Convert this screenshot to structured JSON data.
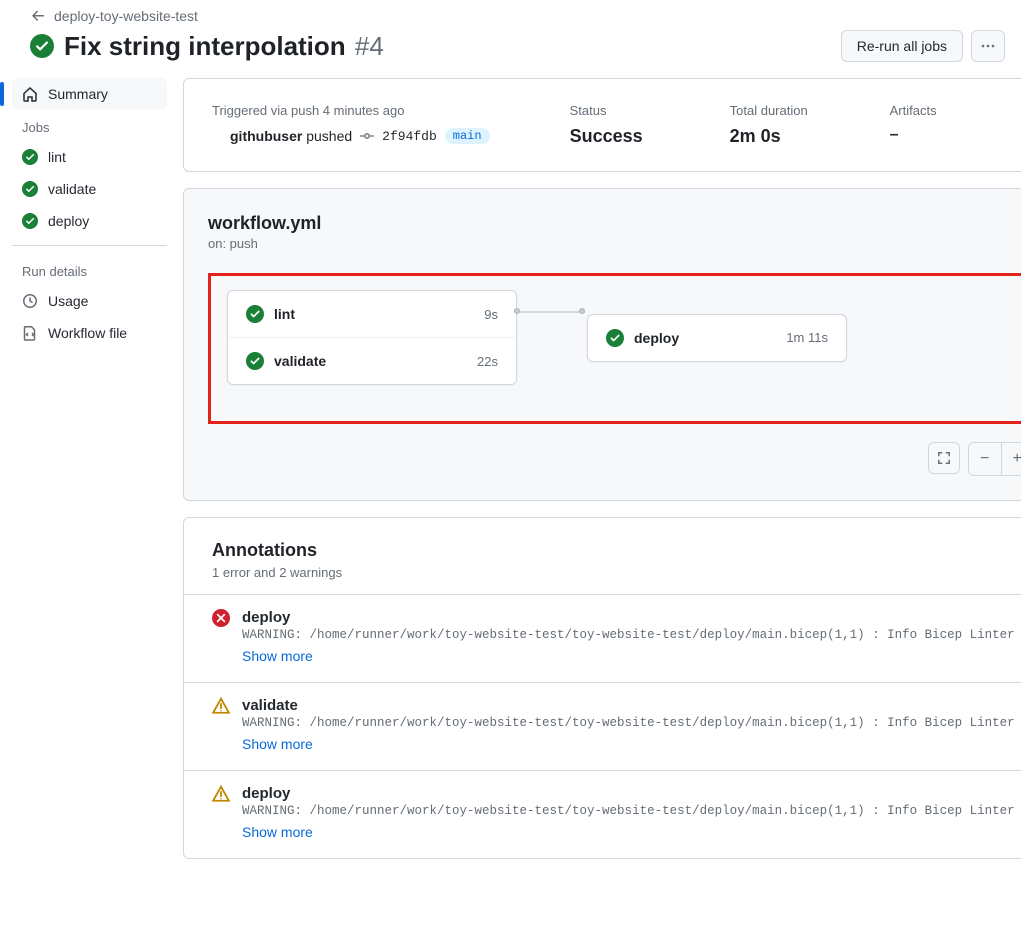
{
  "breadcrumb": "deploy-toy-website-test",
  "title": "Fix string interpolation",
  "run_number": "#4",
  "rerun_label": "Re-run all jobs",
  "sidebar": {
    "summary": "Summary",
    "jobs_heading": "Jobs",
    "jobs": [
      "lint",
      "validate",
      "deploy"
    ],
    "run_heading": "Run details",
    "usage": "Usage",
    "workflow_file": "Workflow file"
  },
  "summary": {
    "trigger_label": "Triggered via push 4 minutes ago",
    "actor": "githubuser",
    "verb": "pushed",
    "commit": "2f94fdb",
    "branch": "main",
    "status_label": "Status",
    "status_value": "Success",
    "duration_label": "Total duration",
    "duration_value": "2m 0s",
    "artifacts_label": "Artifacts",
    "artifacts_value": "–"
  },
  "workflow": {
    "name": "workflow.yml",
    "on": "on: push",
    "left_jobs": [
      {
        "name": "lint",
        "time": "9s"
      },
      {
        "name": "validate",
        "time": "22s"
      }
    ],
    "right_job": {
      "name": "deploy",
      "time": "1m 11s"
    }
  },
  "annotations": {
    "title": "Annotations",
    "subtitle": "1 error and 2 warnings",
    "items": [
      {
        "type": "error",
        "name": "deploy",
        "msg": "WARNING: /home/runner/work/toy-website-test/toy-website-test/deploy/main.bicep(1,1) : Info Bicep Linter …",
        "show_more": "Show more"
      },
      {
        "type": "warning",
        "name": "validate",
        "msg": "WARNING: /home/runner/work/toy-website-test/toy-website-test/deploy/main.bicep(1,1) : Info Bicep Linter …",
        "show_more": "Show more"
      },
      {
        "type": "warning",
        "name": "deploy",
        "msg": "WARNING: /home/runner/work/toy-website-test/toy-website-test/deploy/main.bicep(1,1) : Info Bicep Linter …",
        "show_more": "Show more"
      }
    ]
  }
}
